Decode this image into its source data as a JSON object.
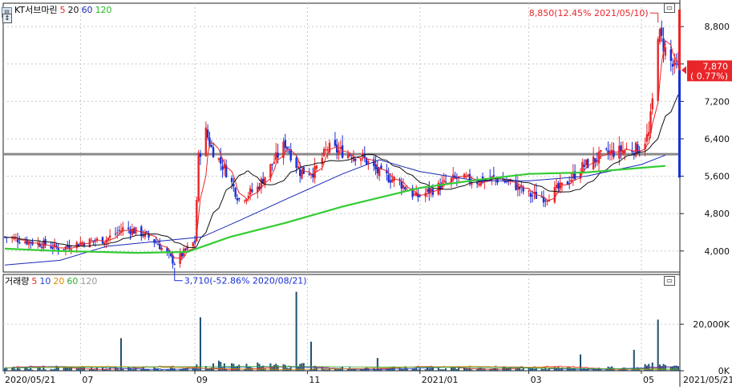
{
  "colors": {
    "up": "#e8262a",
    "down": "#1a2fd6",
    "ma5": "#e8262a",
    "ma20": "#111111",
    "ma60": "#1a2ab8",
    "ma120": "#33cc33",
    "vol10": "#2244cc",
    "vol20": "#e08a00",
    "vol60": "#33aa33",
    "vol120": "#999999",
    "ref_line": "#8a8a8a",
    "grid": "#c8c8c8",
    "frame": "#222222",
    "price_box": "#e8262a"
  },
  "price_panel": {
    "legend": {
      "icon": "chart-icon",
      "title": "KT서브마린",
      "ma5": "5",
      "ma20": "20",
      "ma60": "60",
      "ma120": "120"
    },
    "y_ticks": [
      "8,800",
      "8,000",
      "7,200",
      "6,400",
      "5,600",
      "4,800",
      "4,000"
    ],
    "high_annotation": "8,850(12.45% 2021/05/10)",
    "low_annotation": "3,710(-52.86% 2020/08/21)",
    "current_price": "7,870",
    "current_change": "( 0.77%)"
  },
  "volume_panel": {
    "legend": {
      "title": "거래량",
      "ma5": "5",
      "ma10": "10",
      "ma20": "20",
      "ma60": "60",
      "ma120": "120"
    },
    "y_ticks": [
      "20,000K",
      "0K"
    ]
  },
  "x_axis": {
    "labels": [
      "2020/05/21",
      "07",
      "09",
      "11",
      "2021/01",
      "03",
      "05"
    ],
    "last_label": "2021/05/21"
  },
  "chart_data": {
    "type": "candlestick",
    "title": "KT서브마린",
    "x_range": [
      "2020/05/21",
      "2021/05/21"
    ],
    "price_ylim": [
      3550,
      9300
    ],
    "reference_price": 6070,
    "moving_averages": [
      "5",
      "20",
      "60",
      "120"
    ],
    "high": {
      "value": 8850,
      "change_pct": 12.45,
      "date": "2021/05/10"
    },
    "low": {
      "value": 3710,
      "change_pct": -52.86,
      "date": "2020/08/21"
    },
    "last": {
      "value": 7870,
      "change_pct": 0.77
    },
    "close_path": [
      {
        "date": "2020/05/21",
        "close": 4300
      },
      {
        "date": "2020/06/10",
        "close": 4150
      },
      {
        "date": "2020/06/20",
        "close": 4050
      },
      {
        "date": "2020/07/01",
        "close": 4180
      },
      {
        "date": "2020/07/15",
        "close": 4250
      },
      {
        "date": "2020/07/25",
        "close": 4500
      },
      {
        "date": "2020/08/05",
        "close": 4350
      },
      {
        "date": "2020/08/12",
        "close": 4150
      },
      {
        "date": "2020/08/21",
        "close": 3750
      },
      {
        "date": "2020/08/28",
        "close": 4050
      },
      {
        "date": "2020/09/01",
        "close": 4200
      },
      {
        "date": "2020/09/03",
        "close": 6000
      },
      {
        "date": "2020/09/07",
        "close": 6550
      },
      {
        "date": "2020/09/10",
        "close": 6200
      },
      {
        "date": "2020/09/18",
        "close": 5700
      },
      {
        "date": "2020/09/25",
        "close": 5100
      },
      {
        "date": "2020/10/05",
        "close": 5350
      },
      {
        "date": "2020/10/12",
        "close": 5800
      },
      {
        "date": "2020/10/20",
        "close": 6300
      },
      {
        "date": "2020/10/28",
        "close": 5700
      },
      {
        "date": "2020/11/05",
        "close": 5700
      },
      {
        "date": "2020/11/12",
        "close": 6200
      },
      {
        "date": "2020/11/22",
        "close": 6100
      },
      {
        "date": "2020/12/01",
        "close": 6000
      },
      {
        "date": "2020/12/10",
        "close": 5650
      },
      {
        "date": "2020/12/20",
        "close": 5500
      },
      {
        "date": "2020/12/30",
        "close": 5150
      },
      {
        "date": "2021/01/10",
        "close": 5350
      },
      {
        "date": "2021/01/20",
        "close": 5550
      },
      {
        "date": "2021/02/01",
        "close": 5500
      },
      {
        "date": "2021/02/10",
        "close": 5550
      },
      {
        "date": "2021/02/20",
        "close": 5450
      },
      {
        "date": "2021/03/01",
        "close": 5200
      },
      {
        "date": "2021/03/10",
        "close": 5150
      },
      {
        "date": "2021/03/20",
        "close": 5400
      },
      {
        "date": "2021/03/30",
        "close": 5800
      },
      {
        "date": "2021/04/10",
        "close": 6050
      },
      {
        "date": "2021/04/20",
        "close": 6150
      },
      {
        "date": "2021/04/30",
        "close": 6200
      },
      {
        "date": "2021/05/05",
        "close": 6500
      },
      {
        "date": "2021/05/07",
        "close": 7200
      },
      {
        "date": "2021/05/10",
        "close": 8700
      },
      {
        "date": "2021/05/14",
        "close": 8300
      },
      {
        "date": "2021/05/18",
        "close": 7950
      },
      {
        "date": "2021/05/21",
        "close": 7870
      }
    ],
    "ma120_path": [
      {
        "date": "2020/05/21",
        "value": 4050
      },
      {
        "date": "2020/06/20",
        "value": 4000
      },
      {
        "date": "2020/08/01",
        "value": 3960
      },
      {
        "date": "2020/08/28",
        "value": 3980
      },
      {
        "date": "2020/09/20",
        "value": 4300
      },
      {
        "date": "2020/10/20",
        "value": 4600
      },
      {
        "date": "2020/11/20",
        "value": 4950
      },
      {
        "date": "2021/01/01",
        "value": 5350
      },
      {
        "date": "2021/02/01",
        "value": 5520
      },
      {
        "date": "2021/03/01",
        "value": 5650
      },
      {
        "date": "2021/04/01",
        "value": 5680
      },
      {
        "date": "2021/05/01",
        "value": 5780
      },
      {
        "date": "2021/05/14",
        "value": 5820
      }
    ],
    "ma60_path": [
      {
        "date": "2020/05/21",
        "value": 3700
      },
      {
        "date": "2020/06/20",
        "value": 3800
      },
      {
        "date": "2020/07/15",
        "value": 4100
      },
      {
        "date": "2020/08/10",
        "value": 4200
      },
      {
        "date": "2020/09/05",
        "value": 4300
      },
      {
        "date": "2020/09/25",
        "value": 4650
      },
      {
        "date": "2020/10/20",
        "value": 5100
      },
      {
        "date": "2020/11/20",
        "value": 5650
      },
      {
        "date": "2020/12/10",
        "value": 5950
      },
      {
        "date": "2021/01/01",
        "value": 5700
      },
      {
        "date": "2021/02/01",
        "value": 5500
      },
      {
        "date": "2021/03/01",
        "value": 5500
      },
      {
        "date": "2021/04/01",
        "value": 5600
      },
      {
        "date": "2021/05/01",
        "value": 5850
      },
      {
        "date": "2021/05/14",
        "value": 6050
      }
    ],
    "volume": {
      "y_ticks": [
        "20,000K",
        "0K"
      ],
      "ylim": [
        0,
        38000
      ],
      "spikes": [
        {
          "date": "2020/07/23",
          "value": 14000
        },
        {
          "date": "2020/09/04",
          "value": 23000
        },
        {
          "date": "2020/10/26",
          "value": 34000
        },
        {
          "date": "2020/11/03",
          "value": 12500
        },
        {
          "date": "2021/03/29",
          "value": 7000
        },
        {
          "date": "2021/04/27",
          "value": 9000
        },
        {
          "date": "2021/05/10",
          "value": 22000
        },
        {
          "date": "2020/12/09",
          "value": 5500
        }
      ]
    }
  }
}
